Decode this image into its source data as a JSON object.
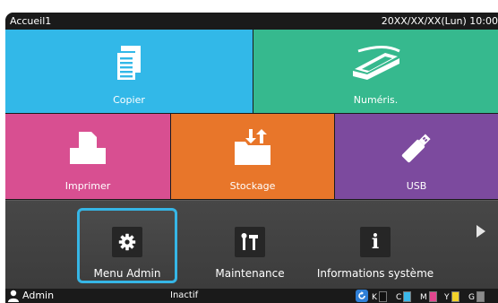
{
  "header": {
    "title": "Accueil1",
    "datetime": "20XX/XX/XX(Lun) 10:00"
  },
  "tiles": {
    "copy": {
      "label": "Copier",
      "color": "#32b8e8"
    },
    "scan": {
      "label": "Numéris.",
      "color": "#36b98e"
    },
    "print": {
      "label": "Imprimer",
      "color": "#d84f91"
    },
    "storage": {
      "label": "Stockage",
      "color": "#e8762a"
    },
    "usb": {
      "label": "USB",
      "color": "#7c4a9e"
    }
  },
  "functions": {
    "admin": {
      "label": "Menu Admin",
      "icon": "gear-icon",
      "selected": true
    },
    "maintenance": {
      "label": "Maintenance",
      "icon": "tools-icon"
    },
    "info": {
      "label": "Informations système",
      "icon": "info-icon"
    }
  },
  "status": {
    "user": "Admin",
    "state": "Inactif",
    "ink": [
      {
        "name": "K",
        "color": "#555555",
        "level": 0.0
      },
      {
        "name": "C",
        "color": "#3bb8ea",
        "level": 1.0
      },
      {
        "name": "M",
        "color": "#e2468f",
        "level": 1.0
      },
      {
        "name": "Y",
        "color": "#f2d22a",
        "level": 1.0
      },
      {
        "name": "G",
        "color": "#8a8a8a",
        "level": 1.0
      }
    ],
    "accent": "#36b6e6"
  }
}
